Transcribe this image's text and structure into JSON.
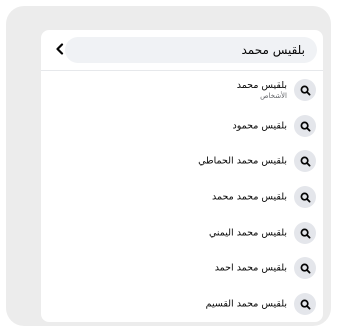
{
  "search": {
    "value": "بلقيس محمد"
  },
  "results": [
    {
      "label": "بلقيس محمد",
      "sub": "الأشخاص"
    },
    {
      "label": "بلقيس محمود"
    },
    {
      "label": "بلقيس محمد الحماطي"
    },
    {
      "label": "بلقيس محمد محمد"
    },
    {
      "label": "بلقيس محمد اليمني"
    },
    {
      "label": "بلقيس محمد احمد"
    },
    {
      "label": "بلقيس محمد القسيم"
    }
  ],
  "icons": {
    "back": "chevron-left-icon",
    "result": "search-icon"
  },
  "colors": {
    "field_bg": "#f0f2f5",
    "badge_bg": "#e4e6eb",
    "text": "#050505",
    "secondary_text": "#65676b"
  }
}
